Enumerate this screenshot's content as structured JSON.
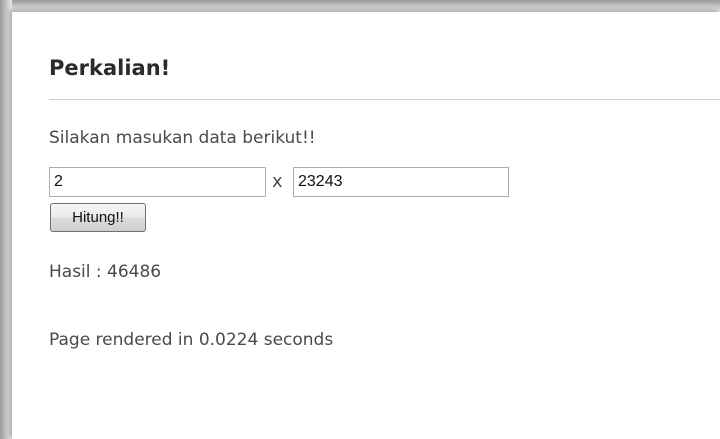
{
  "form": {
    "title": "Perkalian!",
    "instruction": "Silakan masukan data berikut!!",
    "operand_a": "2",
    "operator": "x",
    "operand_b": "23243",
    "submit_label": "Hitung!!"
  },
  "result": {
    "text": "Hasil : 46486"
  },
  "footer": {
    "rendered_text": "Page rendered in 0.0224 seconds"
  },
  "colors": {
    "page_background": "#ffffff",
    "text": "#4a4a4a",
    "title": "#2b2b2b",
    "rule": "#d0d0d0"
  }
}
